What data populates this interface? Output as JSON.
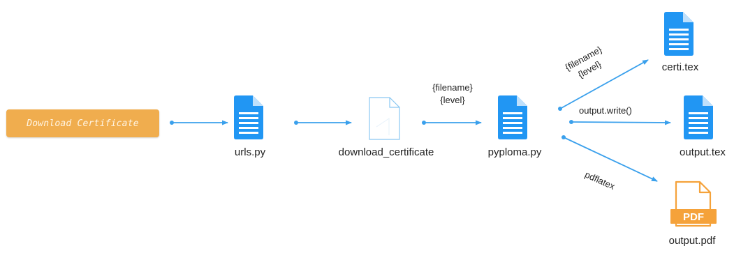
{
  "colors": {
    "edge": "#3aa0ec",
    "file_icon": "#2196f3",
    "file_outline": "#8ac8f2",
    "pdf_icon": "#f5a23a",
    "button_bg": "#f0ad4e",
    "button_text": "#fff5e4"
  },
  "start_button": {
    "label": "Download Certificate"
  },
  "nodes": {
    "urls": {
      "label": "urls.py",
      "icon": "document-icon"
    },
    "download_certificate": {
      "label": "download_certificate",
      "icon": "document-outline-icon"
    },
    "pyploma": {
      "label": "pyploma.py",
      "icon": "document-icon"
    },
    "certi_tex": {
      "label": "certi.tex",
      "icon": "document-icon"
    },
    "output_tex": {
      "label": "output.tex",
      "icon": "document-icon"
    },
    "output_pdf": {
      "label": "output.pdf",
      "icon": "pdf-file-icon",
      "badge": "PDF"
    }
  },
  "edges": {
    "download_to_pyploma": {
      "line1": "{filename}",
      "line2": "{level}"
    },
    "pyploma_to_certi": {
      "line1": "{filename}",
      "line2": "{level}"
    },
    "pyploma_to_output_tex": {
      "label": "output.write()"
    },
    "pyploma_to_output_pdf": {
      "label": "pdflatex"
    }
  }
}
